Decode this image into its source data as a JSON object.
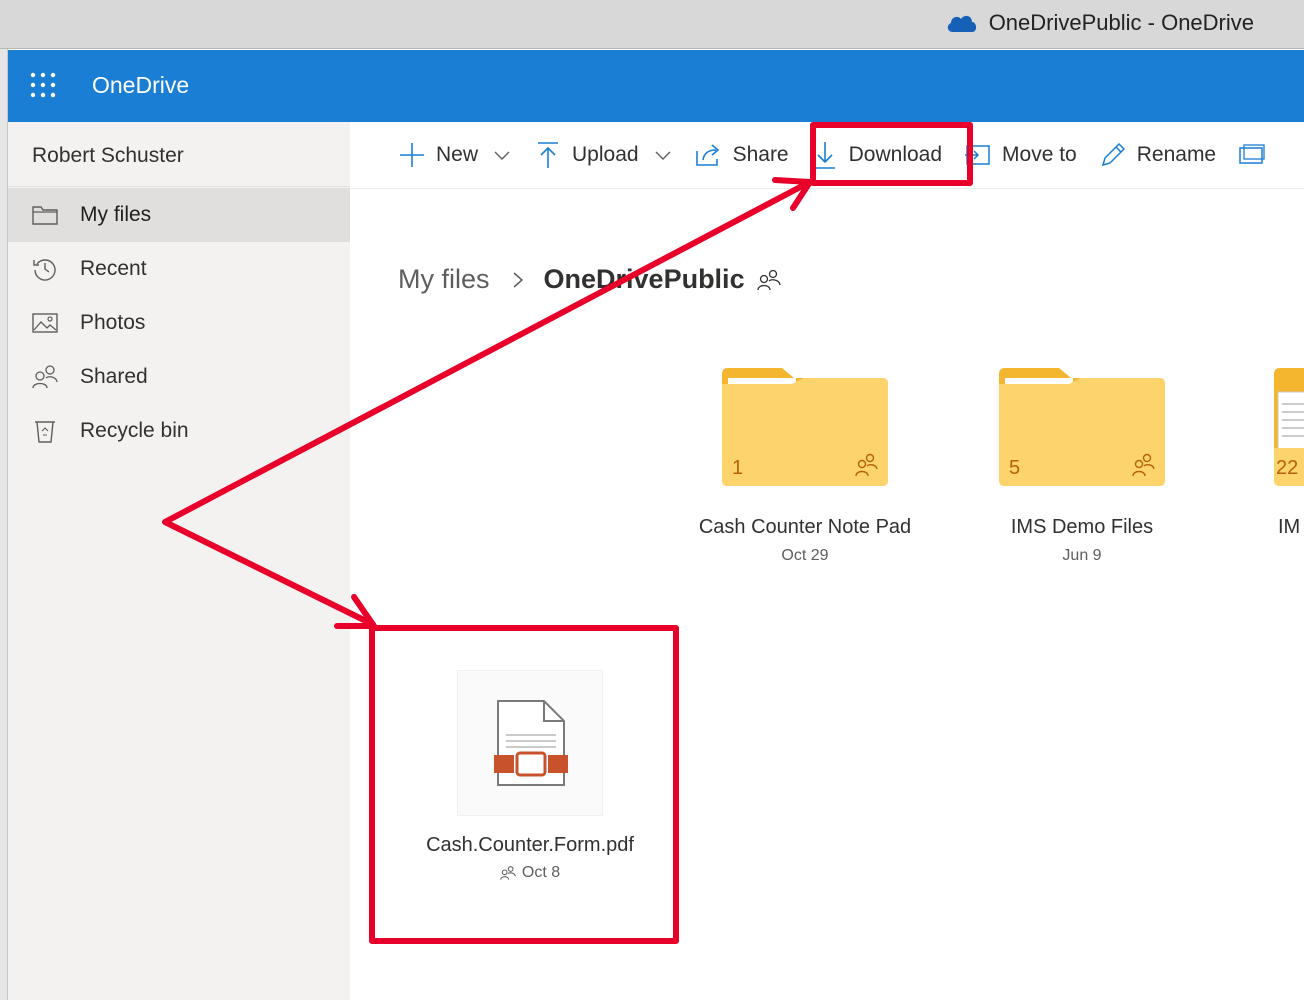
{
  "window": {
    "title": "OneDrivePublic - OneDrive",
    "icon": "onedrive-cloud-icon"
  },
  "appbar": {
    "brand": "OneDrive",
    "waffle_icon": "app-launcher-icon",
    "color": "#1a7ed4"
  },
  "sidebar": {
    "user": "Robert Schuster",
    "items": [
      {
        "label": "My files",
        "icon": "folder-icon",
        "active": true
      },
      {
        "label": "Recent",
        "icon": "history-icon",
        "active": false
      },
      {
        "label": "Photos",
        "icon": "photo-icon",
        "active": false
      },
      {
        "label": "Shared",
        "icon": "people-icon",
        "active": false
      },
      {
        "label": "Recycle bin",
        "icon": "recycle-bin-icon",
        "active": false
      }
    ]
  },
  "commands": {
    "new": "New",
    "upload": "Upload",
    "share": "Share",
    "download": "Download",
    "move_to": "Move to",
    "rename": "Rename"
  },
  "breadcrumb": {
    "parent": "My files",
    "current": "OneDrivePublic"
  },
  "folders": [
    {
      "name": "Cash Counter Note Pad",
      "date": "Oct 29",
      "count": "1",
      "shared": true
    },
    {
      "name": "IMS Demo Files",
      "date": "Jun 9",
      "count": "5",
      "shared": true
    },
    {
      "name": "IM",
      "date": "",
      "count": "22",
      "shared": false
    }
  ],
  "file": {
    "name": "Cash.Counter.Form.pdf",
    "date": "Oct 8",
    "icon": "pdf-file-icon",
    "shared": true
  },
  "annotation": {
    "color": "#e8002a"
  }
}
